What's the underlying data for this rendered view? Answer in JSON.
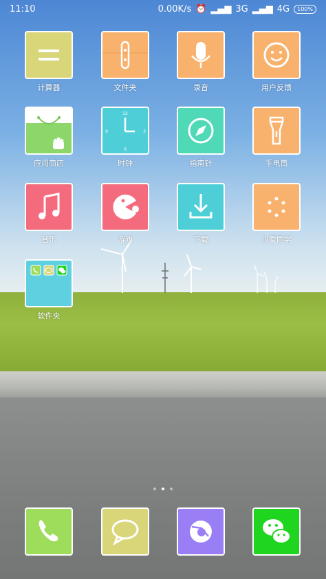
{
  "status_bar": {
    "time": "11:10",
    "net_speed": "0.00K/s",
    "signal_1": "3G",
    "signal_2": "4G",
    "battery": "100%"
  },
  "apps": [
    {
      "label": "计算器",
      "icon": "calculator-icon",
      "color": "#d8d678"
    },
    {
      "label": "文件夹",
      "icon": "file-manager-icon",
      "color": "#f8b26e"
    },
    {
      "label": "录音",
      "icon": "microphone-icon",
      "color": "#f8b26e"
    },
    {
      "label": "用户反馈",
      "icon": "smiley-icon",
      "color": "#f8b26e"
    },
    {
      "label": "应用商店",
      "icon": "app-store-bag-icon",
      "color": "#8cd66a"
    },
    {
      "label": "时钟",
      "icon": "clock-icon",
      "color": "#4ecfd8"
    },
    {
      "label": "指南针",
      "icon": "compass-icon",
      "color": "#4fd9b6"
    },
    {
      "label": "手电筒",
      "icon": "flashlight-icon",
      "color": "#f8b26e"
    },
    {
      "label": "音乐",
      "icon": "music-note-icon",
      "color": "#f36b7c"
    },
    {
      "label": "游戏",
      "icon": "game-pacman-icon",
      "color": "#f36b7c"
    },
    {
      "label": "下载",
      "icon": "download-icon",
      "color": "#4ecfd8"
    },
    {
      "label": "小爱同学",
      "icon": "assistant-dots-icon",
      "color": "#f8b26e"
    }
  ],
  "folder": {
    "label": "软件夹",
    "color": "#5fd0e0",
    "mini_icons": [
      "phone-icon",
      "message-icon",
      "wechat-icon"
    ]
  },
  "page_indicator": {
    "pages": 3,
    "current": 2
  },
  "dock": [
    {
      "icon": "phone-icon",
      "color": "#9ddd5b"
    },
    {
      "icon": "message-icon",
      "color": "#d8d678"
    },
    {
      "icon": "browser-icon",
      "color": "#9a7ef5"
    },
    {
      "icon": "wechat-icon",
      "color": "#1fd51f"
    }
  ]
}
